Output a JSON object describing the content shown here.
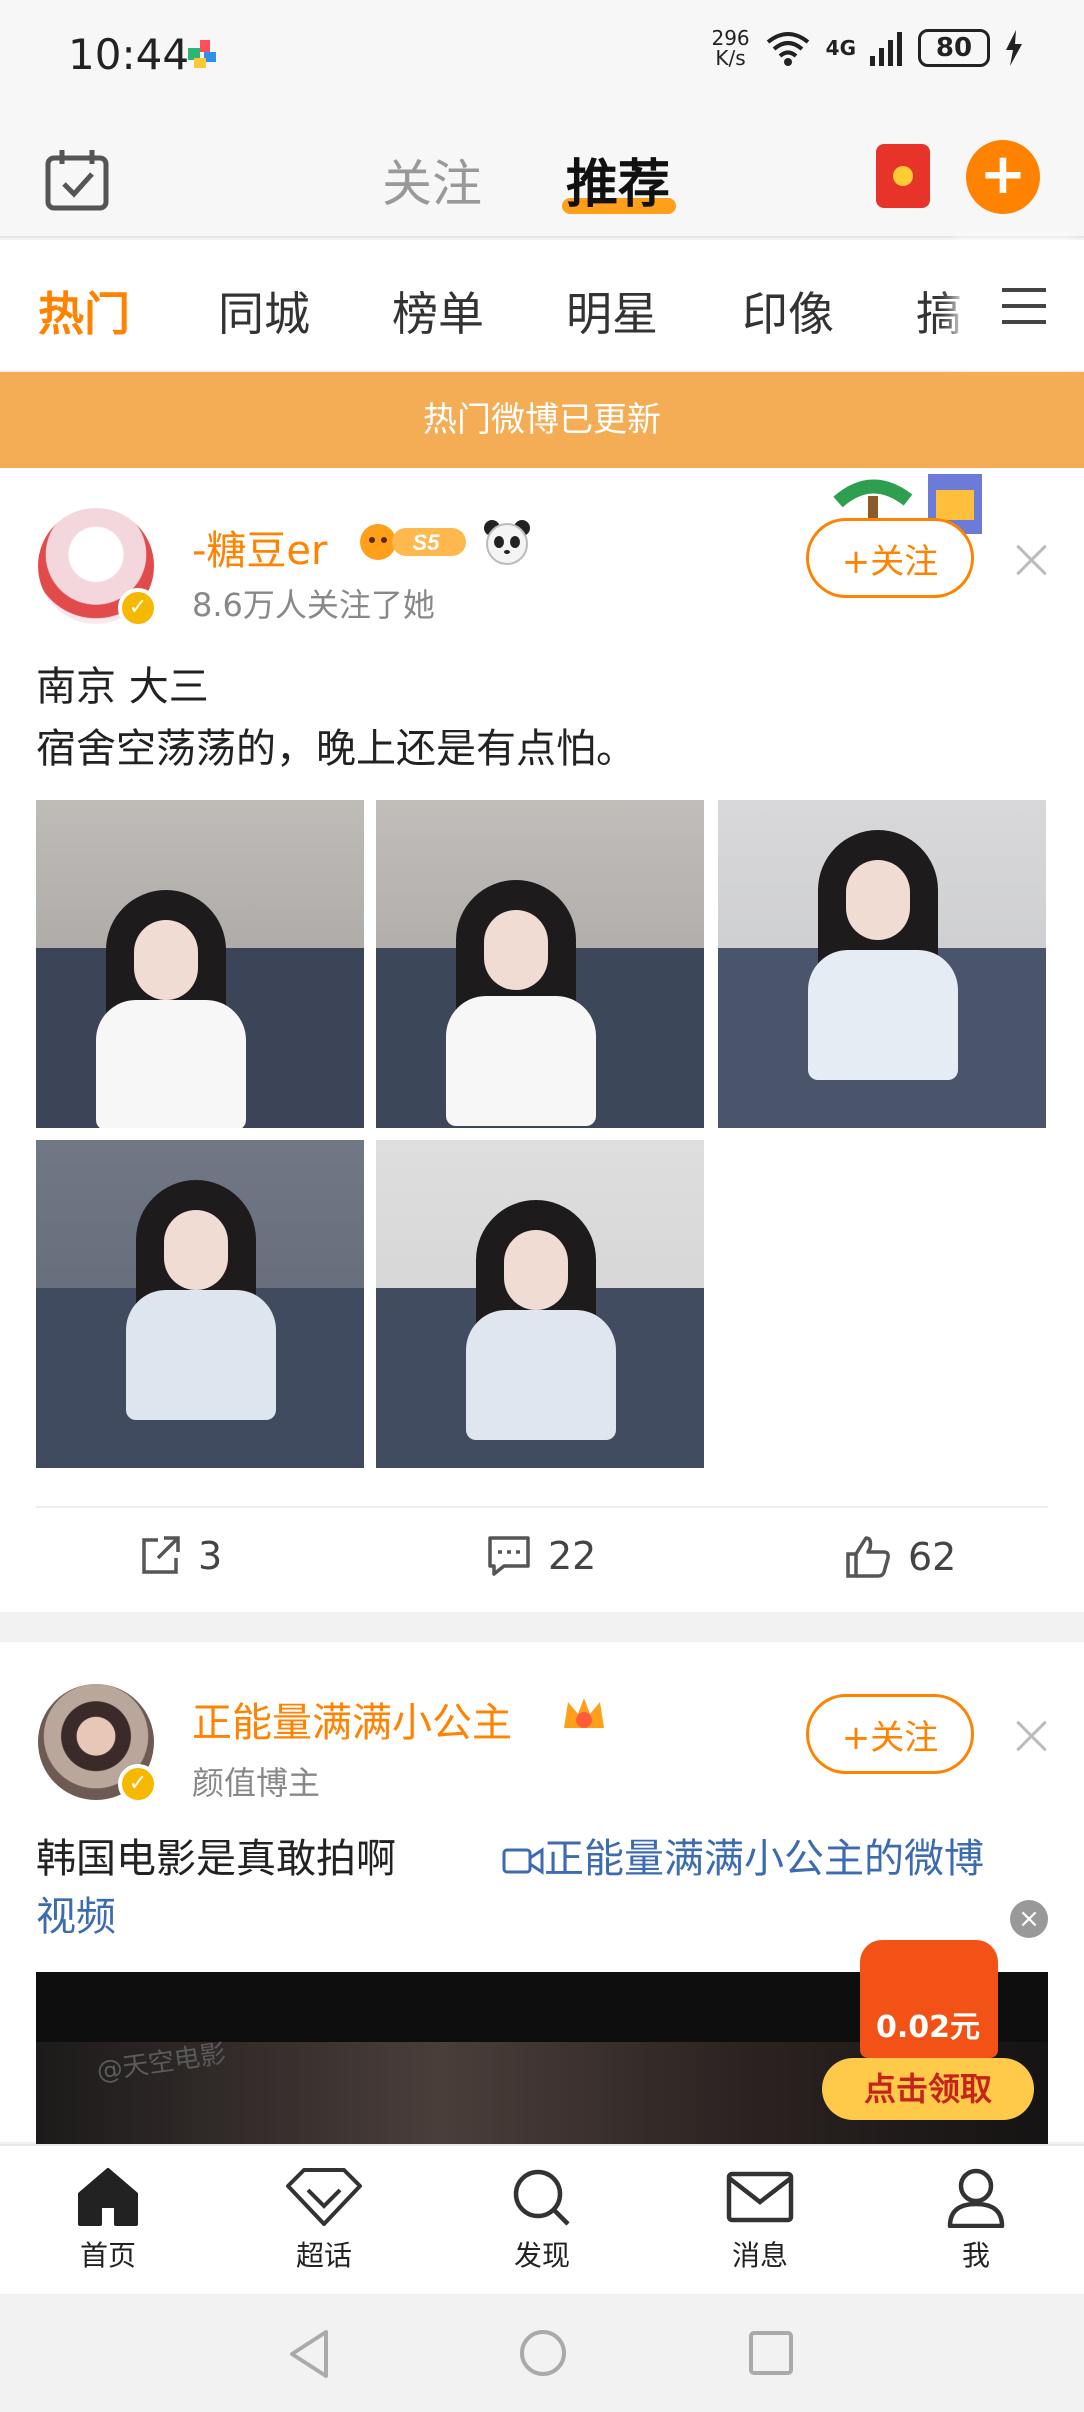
{
  "status_bar": {
    "time": "10:44",
    "net_speed_value": "296",
    "net_speed_unit": "K/s",
    "signal_label": "4G",
    "battery": "80"
  },
  "header": {
    "tabs": [
      {
        "label": "关注",
        "active": false
      },
      {
        "label": "推荐",
        "active": true
      }
    ],
    "calendar_icon": "calendar-check-icon",
    "redpacket_icon": "red-packet-icon",
    "compose_label": "+"
  },
  "categories": {
    "items": [
      {
        "label": "热门",
        "active": true
      },
      {
        "label": "同城",
        "active": false
      },
      {
        "label": "榜单",
        "active": false
      },
      {
        "label": "明星",
        "active": false
      },
      {
        "label": "印像",
        "active": false
      },
      {
        "label": "搞",
        "active": false
      }
    ],
    "menu_icon": "hamburger-icon"
  },
  "banner": {
    "text": "热门微博已更新"
  },
  "posts": [
    {
      "username": "-糖豆er",
      "badge_level": "S5",
      "followers_text": "8.6万人关注了她",
      "follow_label": "+关注",
      "text_lines": [
        "南京 大三",
        "宿舍空荡荡的，晚上还是有点怕。"
      ],
      "photo_count": 5,
      "actions": {
        "repost_count": "3",
        "comment_count": "22",
        "like_count": "62"
      }
    },
    {
      "username": "正能量满满小公主",
      "subtitle": "颜值博主",
      "follow_label": "+关注",
      "text": "韩国电影是真敢拍啊",
      "video_link_line1": "正能量满满小公主的微博",
      "video_link_line2": "视频",
      "video_watermark": "@天空电影"
    }
  ],
  "red_envelope": {
    "amount": "0.02元",
    "claim_label": "点击领取",
    "close_label": "×"
  },
  "bottom_nav": {
    "items": [
      {
        "label": "首页",
        "icon": "home-icon"
      },
      {
        "label": "超话",
        "icon": "diamond-icon"
      },
      {
        "label": "发现",
        "icon": "search-icon"
      },
      {
        "label": "消息",
        "icon": "mail-icon"
      },
      {
        "label": "我",
        "icon": "profile-icon"
      }
    ]
  },
  "colors": {
    "accent": "#ff8200",
    "banner": "#f4ad55",
    "link": "#3c6bb0"
  }
}
